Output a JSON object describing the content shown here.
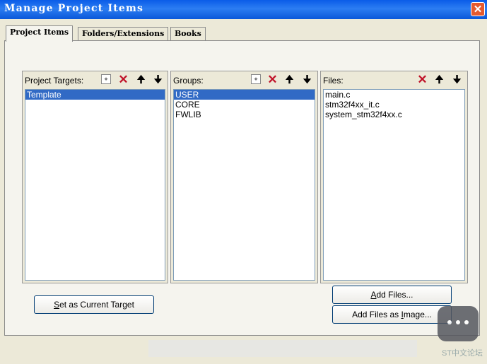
{
  "window": {
    "title": "Manage Project Items",
    "close_glyph": "✕"
  },
  "tabs": [
    "Project Items",
    "Folders/Extensions",
    "Books"
  ],
  "targets": {
    "label": "Project Targets:",
    "items": [
      "Template"
    ],
    "selected": 0
  },
  "groups": {
    "label": "Groups:",
    "items": [
      "USER",
      "CORE",
      "FWLIB"
    ],
    "selected": 0
  },
  "files": {
    "label": "Files:",
    "items": [
      "main.c",
      "stm32f4xx_it.c",
      "system_stm32f4xx.c"
    ]
  },
  "buttons": {
    "set_target_prefix": "S",
    "set_target_rest": "et as Current Target",
    "add_files_prefix": "A",
    "add_files_rest": "dd Files...",
    "add_image_main": "Add Files as ",
    "add_image_ul": "I",
    "add_image_rest": "mage..."
  },
  "icons": {
    "new": "new-icon",
    "delete": "delete-icon",
    "up": "move-up-icon",
    "down": "move-down-icon"
  },
  "glyphs": {
    "delete": "✕",
    "up": "🠉",
    "down": "🠋",
    "new": "✦"
  },
  "watermark": "ST中文论坛"
}
